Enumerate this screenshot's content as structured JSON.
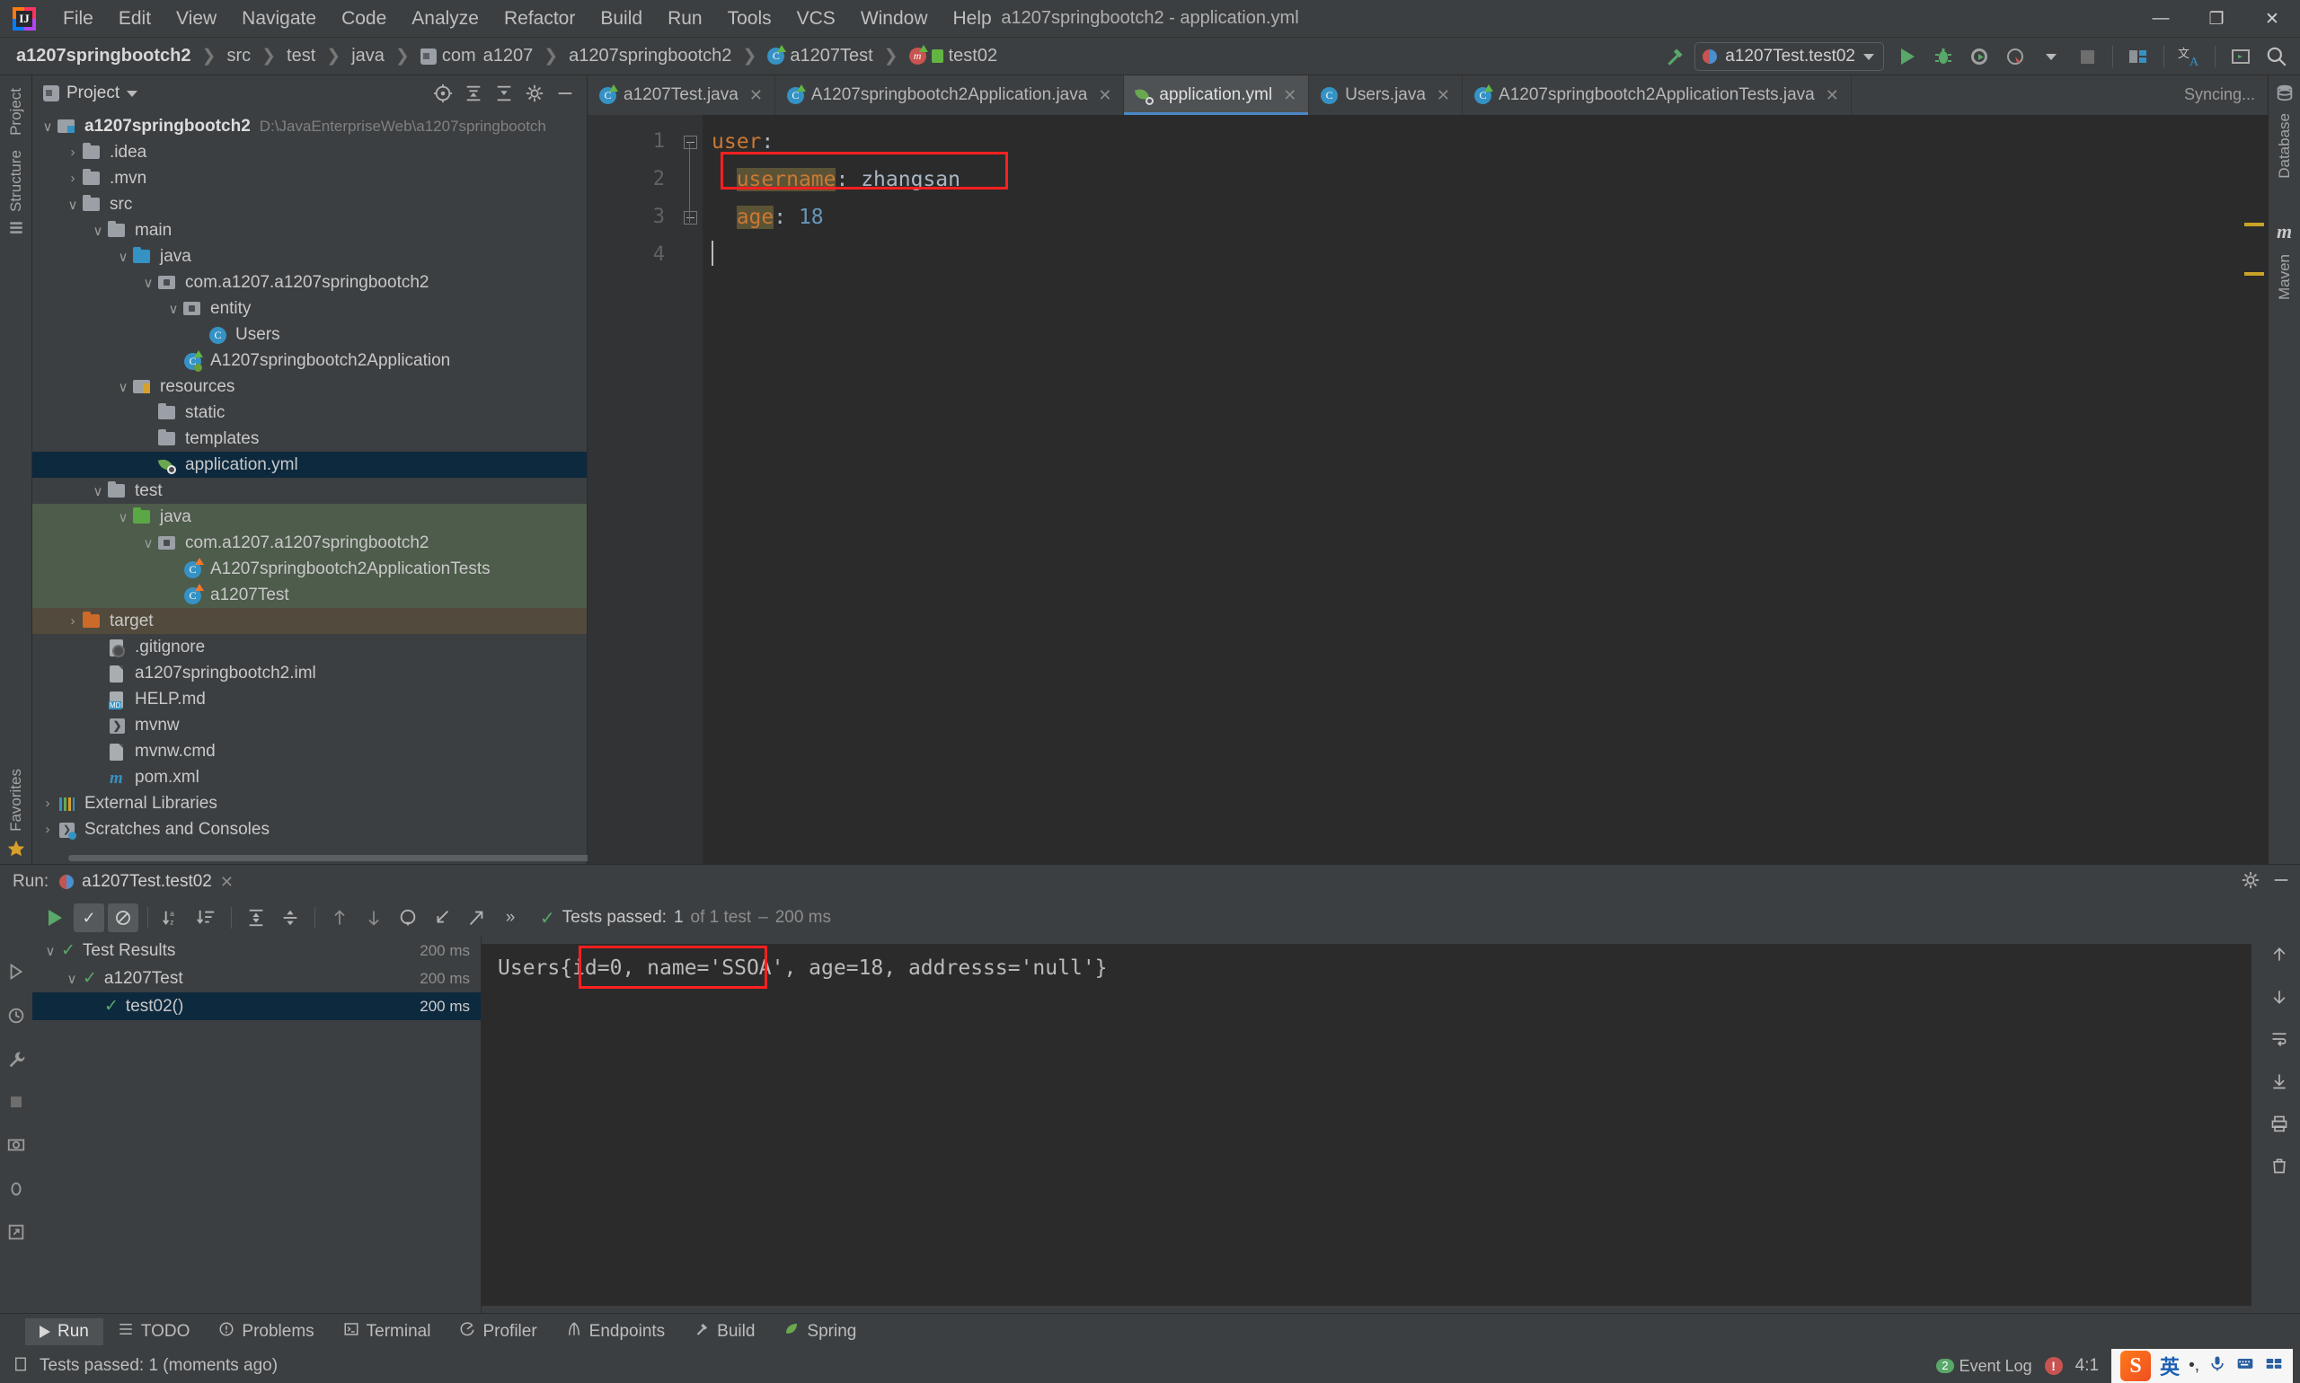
{
  "window": {
    "title": "a1207springbootch2 - application.yml",
    "controls": {
      "minimize": "—",
      "maximize": "❐",
      "close": "✕"
    }
  },
  "menu": [
    "File",
    "Edit",
    "View",
    "Navigate",
    "Code",
    "Analyze",
    "Refactor",
    "Build",
    "Run",
    "Tools",
    "VCS",
    "Window",
    "Help"
  ],
  "breadcrumbs": [
    {
      "label": "a1207springbootch2",
      "icon": "",
      "bold": true
    },
    {
      "label": "src",
      "icon": ""
    },
    {
      "label": "test",
      "icon": ""
    },
    {
      "label": "java",
      "icon": ""
    },
    {
      "label": "com",
      "icon": "folder-icon"
    },
    {
      "label": "a1207",
      "icon": ""
    },
    {
      "label": "a1207springbootch2",
      "icon": ""
    },
    {
      "label": "a1207Test",
      "icon": "class-icon"
    },
    {
      "label": "test02",
      "icon": "method-icon"
    }
  ],
  "toolbar": {
    "run_config": "a1207Test.test02",
    "build_icon": "hammer-icon",
    "run_icon": "run-icon",
    "debug_icon": "debug-icon",
    "run_coverage_icon": "run-with-coverage-icon",
    "profile_icon": "profiler-icon",
    "stop_icon": "stop-icon",
    "search_icon": "search-icon",
    "translate_icon": "translate-icon",
    "terminal_icon": "terminal-icon",
    "project_struct_icon": "project-structure-icon"
  },
  "left_strip": {
    "top": [
      "Project",
      "Structure"
    ],
    "bottom": [
      "Favorites"
    ]
  },
  "right_strip": {
    "items": [
      "Database",
      "Maven"
    ]
  },
  "project_panel": {
    "title": "Project",
    "header_icons": [
      "settings-icon",
      "collapse-all-icon",
      "expand-icon",
      "gear-icon",
      "hide-icon"
    ],
    "tree": [
      {
        "depth": 0,
        "arrow": "∨",
        "icon": "module-icon",
        "label": "a1207springbootch2",
        "path": "D:\\JavaEnterpriseWeb\\a1207springbootch",
        "bold": true,
        "bg": ""
      },
      {
        "depth": 1,
        "arrow": "›",
        "icon": "folder-grey-icon",
        "label": ".idea",
        "path": "",
        "bg": ""
      },
      {
        "depth": 1,
        "arrow": "›",
        "icon": "folder-grey-icon",
        "label": ".mvn",
        "path": "",
        "bg": ""
      },
      {
        "depth": 1,
        "arrow": "∨",
        "icon": "folder-grey-icon",
        "label": "src",
        "path": "",
        "bg": ""
      },
      {
        "depth": 2,
        "arrow": "∨",
        "icon": "folder-grey-icon",
        "label": "main",
        "path": "",
        "bg": ""
      },
      {
        "depth": 3,
        "arrow": "∨",
        "icon": "folder-blue-icon",
        "label": "java",
        "path": "",
        "bg": ""
      },
      {
        "depth": 4,
        "arrow": "∨",
        "icon": "package-icon",
        "label": "com.a1207.a1207springbootch2",
        "path": "",
        "bg": ""
      },
      {
        "depth": 5,
        "arrow": "∨",
        "icon": "package-icon",
        "label": "entity",
        "path": "",
        "bg": ""
      },
      {
        "depth": 6,
        "arrow": "",
        "icon": "class-icon",
        "label": "Users",
        "path": "",
        "bg": ""
      },
      {
        "depth": 5,
        "arrow": "",
        "icon": "spring-class-icon",
        "label": "A1207springbootch2Application",
        "path": "",
        "bg": ""
      },
      {
        "depth": 3,
        "arrow": "∨",
        "icon": "resources-folder-icon",
        "label": "resources",
        "path": "",
        "bg": ""
      },
      {
        "depth": 4,
        "arrow": "",
        "icon": "folder-grey-icon",
        "label": "static",
        "path": "",
        "bg": ""
      },
      {
        "depth": 4,
        "arrow": "",
        "icon": "folder-grey-icon",
        "label": "templates",
        "path": "",
        "bg": ""
      },
      {
        "depth": 4,
        "arrow": "",
        "icon": "spring-yaml-icon",
        "label": "application.yml",
        "path": "",
        "bg": "sel"
      },
      {
        "depth": 2,
        "arrow": "∨",
        "icon": "folder-grey-icon",
        "label": "test",
        "path": "",
        "bg": ""
      },
      {
        "depth": 3,
        "arrow": "∨",
        "icon": "folder-green-icon",
        "label": "java",
        "path": "",
        "bg": "green"
      },
      {
        "depth": 4,
        "arrow": "∨",
        "icon": "package-icon",
        "label": "com.a1207.a1207springbootch2",
        "path": "",
        "bg": "green"
      },
      {
        "depth": 5,
        "arrow": "",
        "icon": "test-class-icon",
        "label": "A1207springbootch2ApplicationTests",
        "path": "",
        "bg": "green"
      },
      {
        "depth": 5,
        "arrow": "",
        "icon": "test-class-icon",
        "label": "a1207Test",
        "path": "",
        "bg": "green"
      },
      {
        "depth": 1,
        "arrow": "›",
        "icon": "folder-orange-icon",
        "label": "target",
        "path": "",
        "bg": "brown"
      },
      {
        "depth": 2,
        "arrow": "",
        "icon": "gitignore-icon",
        "label": ".gitignore",
        "path": "",
        "bg": ""
      },
      {
        "depth": 2,
        "arrow": "",
        "icon": "iml-file-icon",
        "label": "a1207springbootch2.iml",
        "path": "",
        "bg": ""
      },
      {
        "depth": 2,
        "arrow": "",
        "icon": "markdown-icon",
        "label": "HELP.md",
        "path": "",
        "bg": ""
      },
      {
        "depth": 2,
        "arrow": "",
        "icon": "shell-script-icon",
        "label": "mvnw",
        "path": "",
        "bg": ""
      },
      {
        "depth": 2,
        "arrow": "",
        "icon": "cmd-file-icon",
        "label": "mvnw.cmd",
        "path": "",
        "bg": ""
      },
      {
        "depth": 2,
        "arrow": "",
        "icon": "maven-icon",
        "label": "pom.xml",
        "path": "",
        "bg": ""
      },
      {
        "depth": 0,
        "arrow": "›",
        "icon": "libraries-icon",
        "label": "External Libraries",
        "path": "",
        "bg": ""
      },
      {
        "depth": 0,
        "arrow": "›",
        "icon": "scratches-icon",
        "label": "Scratches and Consoles",
        "path": "",
        "bg": ""
      }
    ]
  },
  "editor": {
    "tabs": [
      {
        "label": "a1207Test.java",
        "icon": "test-class-icon",
        "active": false
      },
      {
        "label": "A1207springbootch2Application.java",
        "icon": "spring-class-icon",
        "active": false
      },
      {
        "label": "application.yml",
        "icon": "spring-yaml-icon",
        "active": true
      },
      {
        "label": "Users.java",
        "icon": "class-icon",
        "active": false
      },
      {
        "label": "A1207springbootch2ApplicationTests.java",
        "icon": "test-class-icon",
        "active": false
      }
    ],
    "sync_status": "Syncing...",
    "line_numbers": [
      "1",
      "2",
      "3",
      "4"
    ],
    "lines": [
      {
        "indent": "",
        "key": "user",
        "colon": ":",
        "value": "",
        "highlight": false
      },
      {
        "indent": "  ",
        "key": "username",
        "colon": ":",
        "value": " zhangsan",
        "highlight": true
      },
      {
        "indent": "  ",
        "key": "age",
        "colon": ":",
        "value": " 18",
        "highlight": true
      },
      {
        "indent": "",
        "key": "",
        "colon": "",
        "value": "",
        "highlight": false
      }
    ]
  },
  "run_window": {
    "label": "Run:",
    "tab_name": "a1207Test.test02",
    "toolbar_icons": [
      "rerun-icon",
      "show-passed-icon",
      "hide-ignored-icon",
      "sort-alphabetically-icon",
      "sort-duration-icon",
      "expand-all-icon",
      "collapse-all-icon",
      "prev-icon",
      "next-icon",
      "history-icon",
      "import-icon",
      "export-icon",
      "more-icon"
    ],
    "status": {
      "prefix": "Tests passed:",
      "count": "1",
      "of": "of 1 test",
      "dash": "–",
      "time": "200 ms"
    },
    "tree": [
      {
        "depth": 0,
        "arrow": "∨",
        "label": "Test Results",
        "time": "200 ms",
        "selected": false
      },
      {
        "depth": 1,
        "arrow": "∨",
        "label": "a1207Test",
        "time": "200 ms",
        "selected": false
      },
      {
        "depth": 2,
        "arrow": "",
        "label": "test02()",
        "time": "200 ms",
        "selected": true
      }
    ],
    "console_output": "Users{id=0, name='SSOA', age=18, addresss='null'}"
  },
  "bottom_tools": [
    {
      "label": "Run",
      "icon": "run-icon",
      "active": true
    },
    {
      "label": "TODO",
      "icon": "todo-icon",
      "active": false
    },
    {
      "label": "Problems",
      "icon": "problems-icon",
      "active": false
    },
    {
      "label": "Terminal",
      "icon": "terminal-icon",
      "active": false
    },
    {
      "label": "Profiler",
      "icon": "profiler-icon",
      "active": false
    },
    {
      "label": "Endpoints",
      "icon": "endpoints-icon",
      "active": false
    },
    {
      "label": "Build",
      "icon": "build-icon",
      "active": false
    },
    {
      "label": "Spring",
      "icon": "spring-icon",
      "active": false
    }
  ],
  "status_bar": {
    "message": "Tests passed: 1 (moments ago)",
    "caret_position": "4:1",
    "event_log": "Event Log",
    "event_badge": "2",
    "ime": {
      "logo": "S",
      "mode": "英",
      "punct": "•,",
      "mic": "mic-icon",
      "keyboard": "keyboard-icon",
      "tools": "toolbox-icon"
    }
  },
  "colors": {
    "accent_blue": "#4a88c7",
    "selection": "#0d293e",
    "green": "#59a869",
    "highlight_red": "#ff2020",
    "test_source_bg": "#4e5c4b",
    "target_bg": "#524a3c"
  }
}
